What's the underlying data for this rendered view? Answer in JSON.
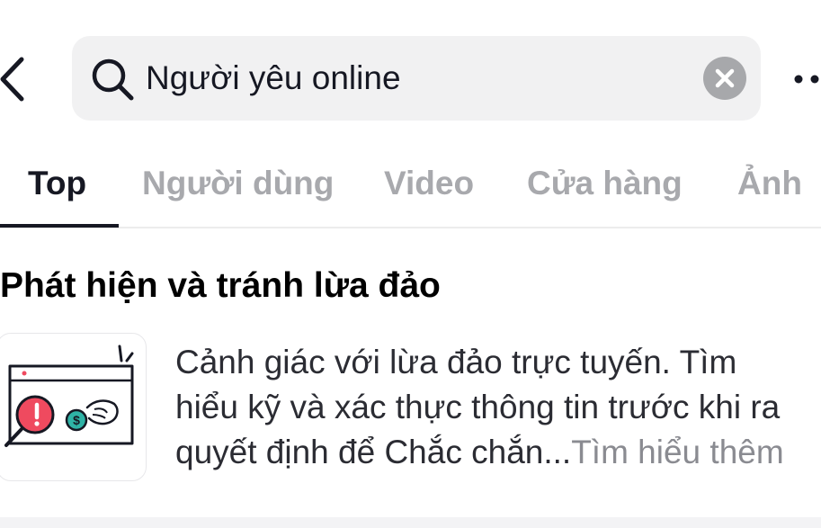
{
  "header": {
    "back_icon": "chevron-left-icon",
    "search": {
      "icon": "search-icon",
      "value": "Người yêu online",
      "clear_icon": "close-icon"
    },
    "more_icon": "more-horizontal-icon"
  },
  "tabs": [
    {
      "label": "Top",
      "active": true
    },
    {
      "label": "Người dùng",
      "active": false
    },
    {
      "label": "Video",
      "active": false
    },
    {
      "label": "Cửa hàng",
      "active": false
    },
    {
      "label": "Ảnh",
      "active": false
    }
  ],
  "scam_notice": {
    "title": "Phát hiện và tránh lừa đảo",
    "illustration_icon": "scam-warning-illustration-icon",
    "body_lines": [
      "Cảnh giác với lừa đảo trực tuyến. Tìm",
      "hiểu kỹ và xác thực thông tin trước khi ra",
      "quyết định để Chắc chắn..."
    ],
    "learn_more": "Tìm hiểu thêm"
  },
  "colors": {
    "text_primary": "#161823",
    "tab_inactive": "#a8a9ad",
    "search_bg": "#f1f1f2",
    "clear_bg": "#a7a8ab",
    "alert_red": "#ef4a5f",
    "coin_teal": "#2fb3a6",
    "learn_more": "#8a8b91"
  }
}
